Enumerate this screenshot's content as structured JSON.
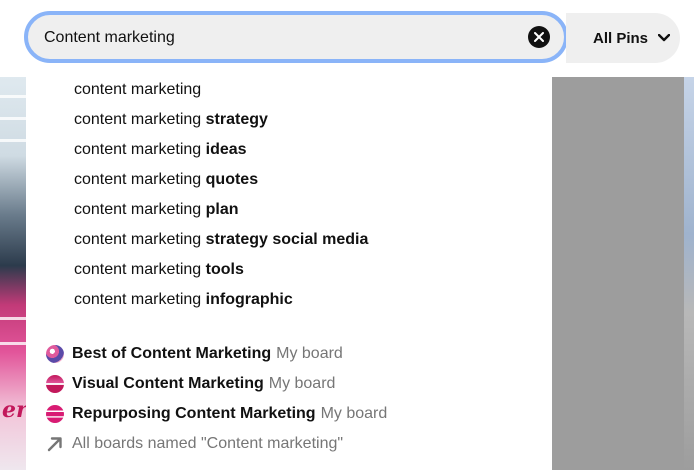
{
  "search": {
    "value": "Content marketing",
    "clear_icon": "close-circle-icon"
  },
  "filter": {
    "label": "All Pins",
    "icon": "chevron-down-icon"
  },
  "suggestions": [
    {
      "prefix": "content marketing",
      "suffix": ""
    },
    {
      "prefix": "content marketing",
      "suffix": "strategy"
    },
    {
      "prefix": "content marketing",
      "suffix": "ideas"
    },
    {
      "prefix": "content marketing",
      "suffix": "quotes"
    },
    {
      "prefix": "content marketing",
      "suffix": "plan"
    },
    {
      "prefix": "content marketing",
      "suffix": "strategy social media"
    },
    {
      "prefix": "content marketing",
      "suffix": "tools"
    },
    {
      "prefix": "content marketing",
      "suffix": "infographic"
    }
  ],
  "boards": [
    {
      "name": "Best of Content Marketing",
      "meta": "My board",
      "icon": "board-thumbnail-icon"
    },
    {
      "name": "Visual Content Marketing",
      "meta": "My board",
      "icon": "board-thumbnail-icon"
    },
    {
      "name": "Repurposing Content Marketing",
      "meta": "My board",
      "icon": "board-thumbnail-icon"
    }
  ],
  "all_boards": {
    "label": "All boards named \"Content marketing\"",
    "icon": "arrow-up-right-icon"
  },
  "colors": {
    "focus_ring": "#8ab4f8",
    "input_bg": "#efefef",
    "muted_text": "#767676",
    "overlay_gray": "#9d9d9d"
  }
}
